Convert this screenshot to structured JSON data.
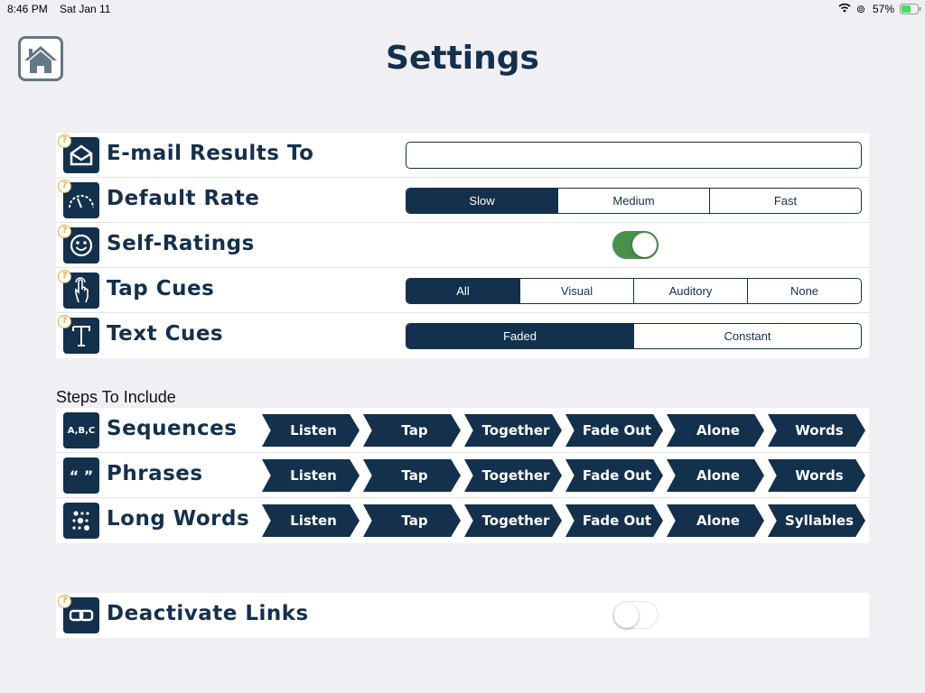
{
  "status_bar": {
    "time": "8:46 PM",
    "date": "Sat Jan 11",
    "battery": "57%"
  },
  "header": {
    "title": "Settings"
  },
  "settings": {
    "email": {
      "label": "E-mail Results To",
      "value": "",
      "placeholder": ""
    },
    "rate": {
      "label": "Default Rate",
      "options": [
        "Slow",
        "Medium",
        "Fast"
      ],
      "selected": "Slow"
    },
    "self_ratings": {
      "label": "Self-Ratings",
      "on": true
    },
    "tap_cues": {
      "label": "Tap Cues",
      "options": [
        "All",
        "Visual",
        "Auditory",
        "None"
      ],
      "selected": "All"
    },
    "text_cues": {
      "label": "Text Cues",
      "options": [
        "Faded",
        "Constant"
      ],
      "selected": "Faded"
    }
  },
  "steps": {
    "title": "Steps To Include",
    "rows": [
      {
        "label": "Sequences",
        "icon_text": "A,B,C",
        "steps": [
          "Listen",
          "Tap",
          "Together",
          "Fade Out",
          "Alone",
          "Words"
        ]
      },
      {
        "label": "Phrases",
        "icon_text": "“ ”",
        "steps": [
          "Listen",
          "Tap",
          "Together",
          "Fade Out",
          "Alone",
          "Words"
        ]
      },
      {
        "label": "Long Words",
        "icon_text": "",
        "steps": [
          "Listen",
          "Tap",
          "Together",
          "Fade Out",
          "Alone",
          "Syllables"
        ]
      }
    ]
  },
  "deactivate": {
    "label": "Deactivate Links",
    "on": false
  },
  "help_glyph": "?",
  "colors": {
    "navy": "#13304d",
    "toggle_on": "#4a8f4a",
    "help": "#f0a830"
  }
}
